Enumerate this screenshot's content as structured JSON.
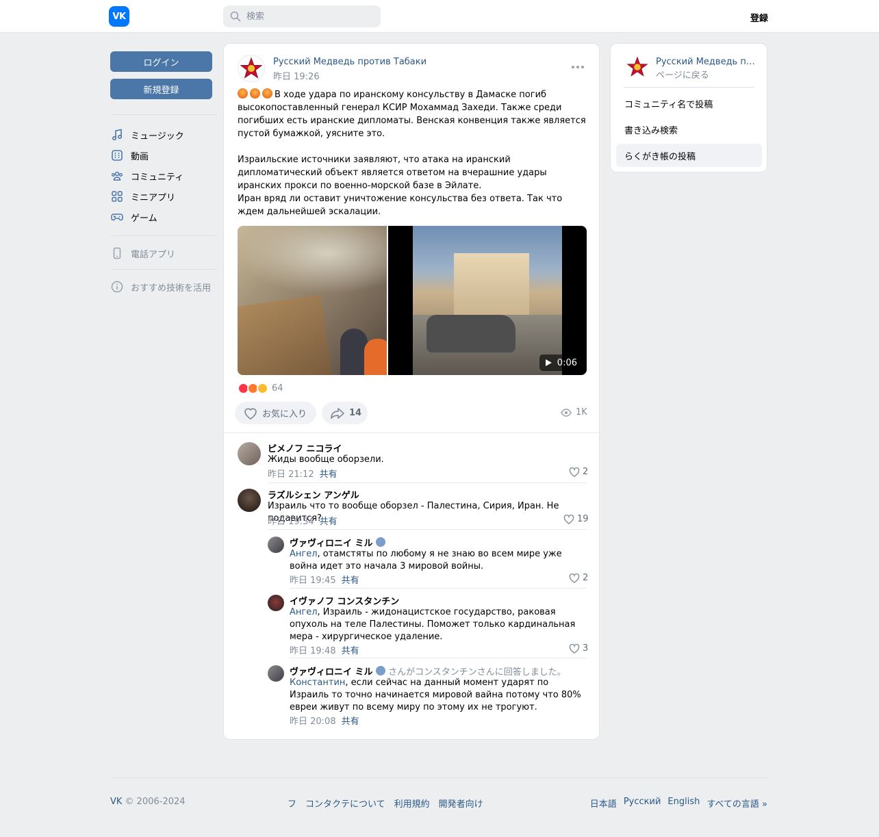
{
  "header": {
    "logo_text": "VK",
    "search_placeholder": "検索",
    "register_label": "登録"
  },
  "sidebar": {
    "login_label": "ログイン",
    "signup_label": "新規登録",
    "items": [
      {
        "label": "ミュージック",
        "icon": "music-icon"
      },
      {
        "label": "動画",
        "icon": "video-icon"
      },
      {
        "label": "コミュニティ",
        "icon": "community-icon"
      },
      {
        "label": "ミニアプリ",
        "icon": "mini-apps-icon"
      },
      {
        "label": "ゲーム",
        "icon": "games-icon"
      }
    ],
    "phone_app_label": "電話アプリ",
    "tech_label": "おすすめ技術を活用"
  },
  "post": {
    "author": "Русский Медведь против Табаки",
    "time": "昨日 19:26",
    "text": "В ходе удара по иранскому консульству в Дамаске погиб высокопоставленный генерал КСИР Мохаммад Захеди. Также среди погибших есть иранские дипломаты. Венская конвенция также является пустой бумажкой, уясните это.\n\nИзраильские источники заявляют, что атака на иранский дипломатический объект является ответом на вчерашние удары иранских прокси по военно-морской базе в Эйлате.\nИран вряд ли оставит уничтожение консульства без ответа. Так что ждем дальнейшей эскалации.",
    "video_duration": "0:06",
    "reactions_count": "64",
    "like_label": "お気に入り",
    "share_count": "14",
    "views": "1K"
  },
  "comments": [
    {
      "name": "ピメノフ ニコライ",
      "text": "Жиды вообще оборзели.",
      "time": "昨日 21:12",
      "share": "共有",
      "likes": "2"
    },
    {
      "name": "ラズルシェン アンゲル",
      "text": "Израиль что то вообще оборзел - Палестина, Сирия, Иран. Не подавится?",
      "time": "昨日 19:34",
      "share": "共有",
      "likes": "19"
    }
  ],
  "replies": [
    {
      "name": "ヴァヴィロニイ ミル",
      "mention": "Ангел",
      "text": ", отамстяты по любому я не знаю во всем мире уже война идет это начала 3 мировой войны.",
      "time": "昨日 19:45",
      "share": "共有",
      "likes": "2"
    },
    {
      "name": "イヴァノフ コンスタンチン",
      "mention": "Ангел",
      "text": ", Израиль - жидонацистское государство, раковая опухоль на теле Палестины. Поможет только кардинальная мера - хирургическое удаление.",
      "time": "昨日 19:48",
      "share": "共有",
      "likes": "3"
    },
    {
      "name": "ヴァヴィロニイ ミル",
      "reply_note": "さんがコンスタンチンさんに回答しました。",
      "mention": "Константин",
      "text": ", если сейчас на данный момент ударят по Израиль то точно начинается мировой вайна потому что 80% евреи живут по всему миру по этому их не трогуют.",
      "time": "昨日 20:08",
      "share": "共有"
    }
  ],
  "side": {
    "name": "Русский Медведь про...",
    "back_label": "ページに戻る",
    "items": [
      "コミュニティ名で投稿",
      "書き込み検索",
      "らくがき帳の投稿"
    ]
  },
  "footer": {
    "brand": "VK",
    "copyright": " © 2006-2024",
    "links": [
      "フ",
      "コンタクテについて",
      "利用規約",
      "開発者向け"
    ],
    "langs": [
      "日本語",
      "Русский",
      "English",
      "すべての言語 »"
    ]
  },
  "colors": {
    "accent": "#4a76a8",
    "link": "#2a5885",
    "muted": "#818c99",
    "background": "#edeef0"
  }
}
